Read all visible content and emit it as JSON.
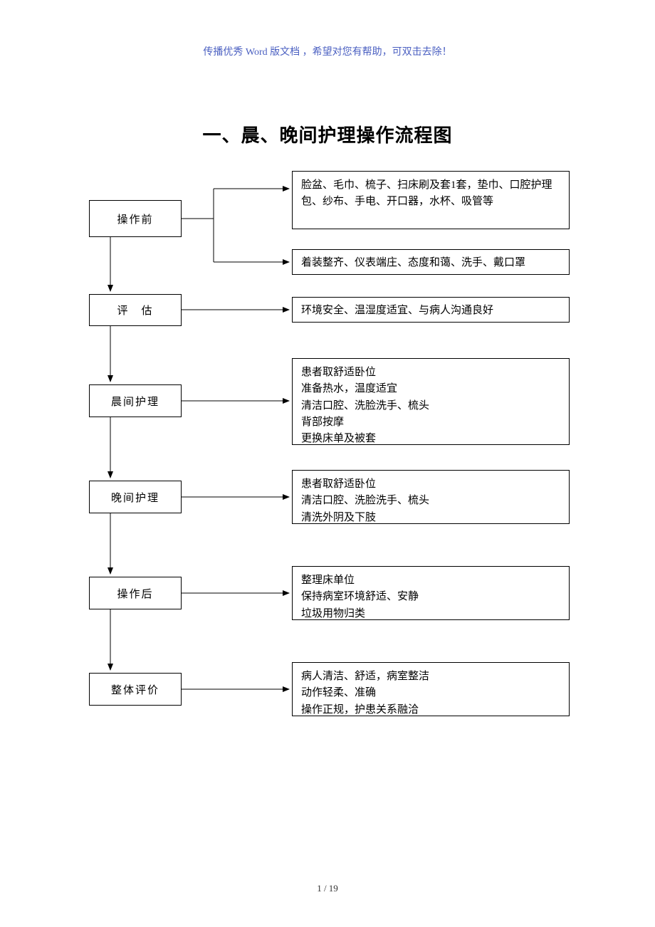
{
  "header_note": "传播优秀 Word 版文档 ，希望对您有帮助，可双击去除！",
  "title": "一、晨、晚间护理操作流程图",
  "footer": "1 / 19",
  "steps": {
    "s1": {
      "label": "操作前"
    },
    "s2": {
      "label": "评　估"
    },
    "s3": {
      "label": "晨间护理"
    },
    "s4": {
      "label": "晚间护理"
    },
    "s5": {
      "label": "操作后"
    },
    "s6": {
      "label": "整体评价"
    }
  },
  "boxes": {
    "b1a": "脸盆、毛巾、梳子、扫床刷及套1套，垫巾、口腔护理包、纱布、手电、开口器，水杯、吸管等",
    "b1b": "着装整齐、仪表端庄、态度和蔼、洗手、戴口罩",
    "b2": "环境安全、温湿度适宜、与病人沟通良好",
    "b3": "患者取舒适卧位\n准备热水，温度适宜\n清洁口腔、洗脸洗手、梳头\n背部按摩\n更换床单及被套",
    "b4": "患者取舒适卧位\n清洁口腔、洗脸洗手、梳头\n清洗外阴及下肢",
    "b5": "整理床单位\n保持病室环境舒适、安静\n垃圾用物归类",
    "b6": "病人清洁、舒适，病室整洁\n动作轻柔、准确\n操作正规，护患关系融洽"
  }
}
